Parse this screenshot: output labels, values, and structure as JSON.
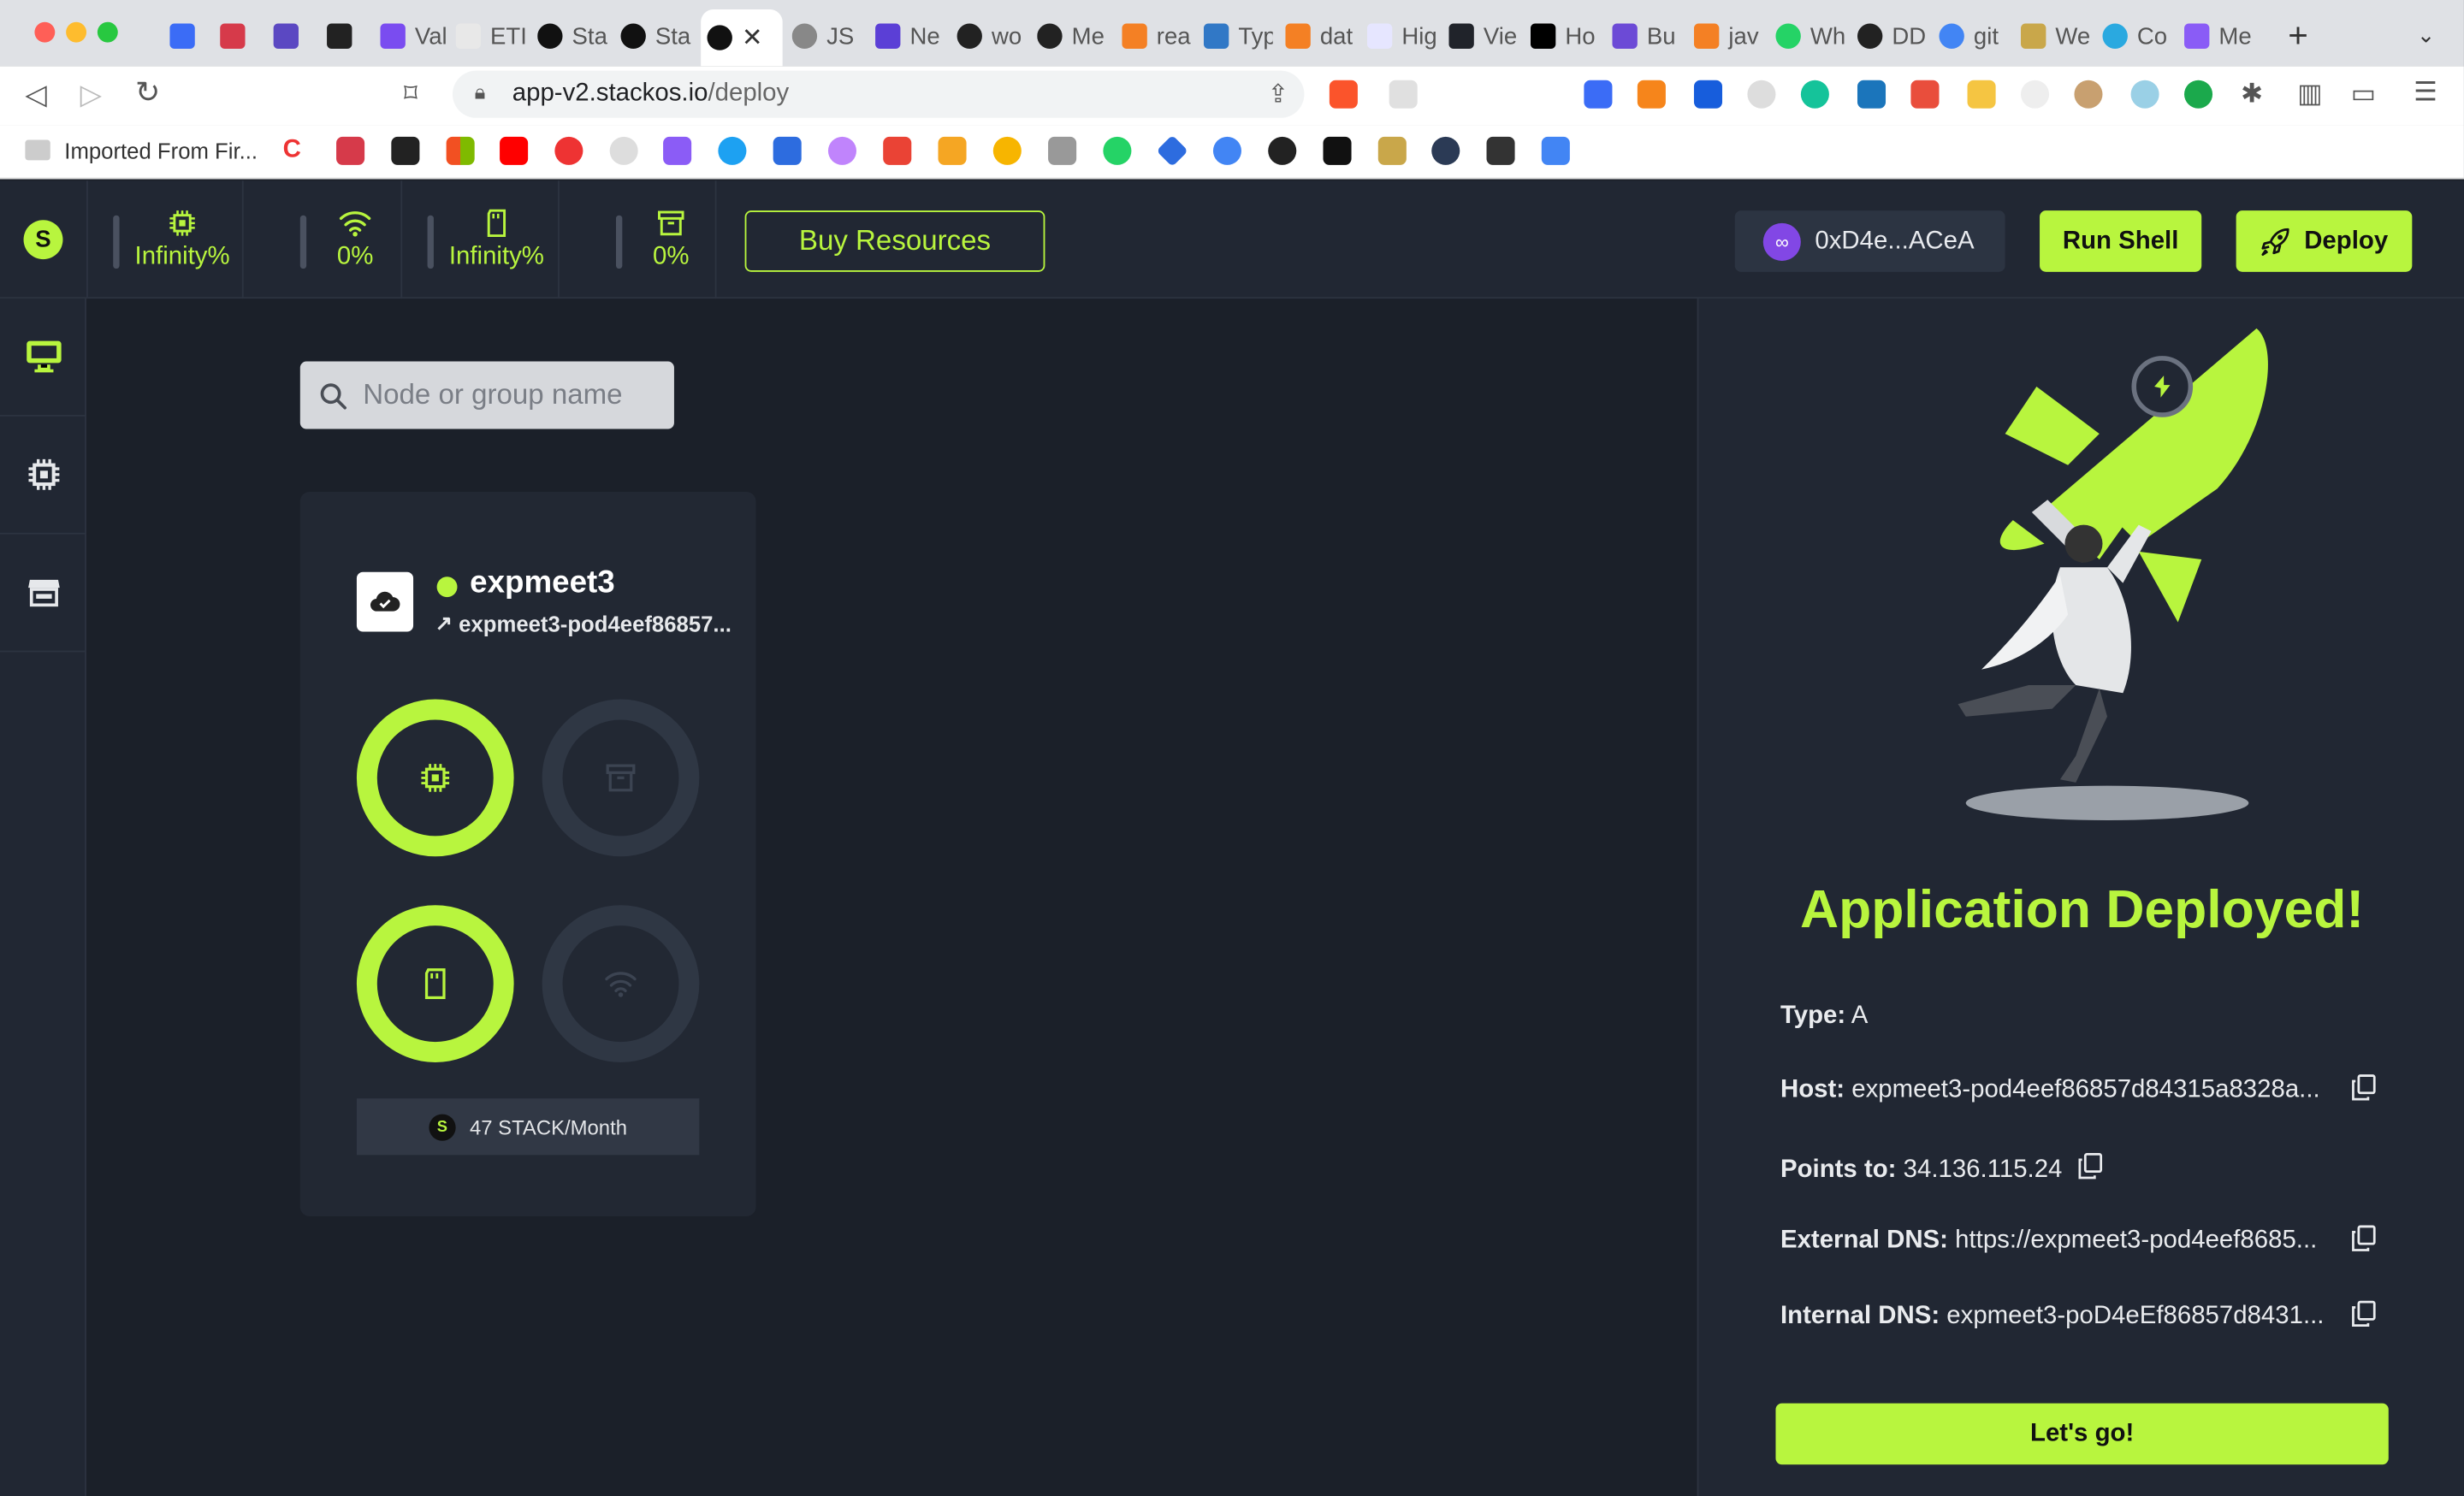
{
  "browser": {
    "url_host": "app-v2.stackos.io",
    "url_path": "/deploy",
    "bookmark_folder": "Imported From Fir...",
    "tabs": [
      "Val",
      "ETI",
      "Sta",
      "Sta",
      "JS",
      "Ne",
      "wo",
      "Me",
      "rea",
      "Typ",
      "dat",
      "Hig",
      "Vie",
      "Ho",
      "Bu",
      "jav",
      "Wh",
      "DD",
      "git",
      "We",
      "Co",
      "Me"
    ]
  },
  "resources": [
    {
      "name": "cpu-icon",
      "value": "Infinity%"
    },
    {
      "name": "wifi-icon",
      "value": "0%"
    },
    {
      "name": "memory-icon",
      "value": "Infinity%"
    },
    {
      "name": "storage-icon",
      "value": "0%"
    }
  ],
  "topbar": {
    "buy_resources": "Buy Resources",
    "wallet_address": "0xD4e...ACeA",
    "run_shell": "Run Shell",
    "deploy": "Deploy"
  },
  "search": {
    "placeholder": "Node or group name"
  },
  "node_card": {
    "name": "expmeet3",
    "status": "online",
    "link": "expmeet3-pod4eef86857...",
    "rings": {
      "cpu": "active",
      "storage": "inactive",
      "memory": "active",
      "network": "inactive"
    },
    "price": "47 STACK/Month"
  },
  "deploy_panel": {
    "title": "Application Deployed!",
    "type_label": "Type:",
    "type_value": "A",
    "host_label": "Host:",
    "host_value": "expmeet3-pod4eef86857d84315a8328a...",
    "points_label": "Points to:",
    "points_value": "34.136.115.24",
    "external_label": "External DNS:",
    "external_value": "https://expmeet3-pod4eef8685...",
    "internal_label": "Internal DNS:",
    "internal_value": "expmeet3-poD4eEf86857d8431...",
    "cta": "Let's go!"
  },
  "colors": {
    "accent": "#b8f53e",
    "bg": "#1b2029",
    "panel": "#212733"
  }
}
